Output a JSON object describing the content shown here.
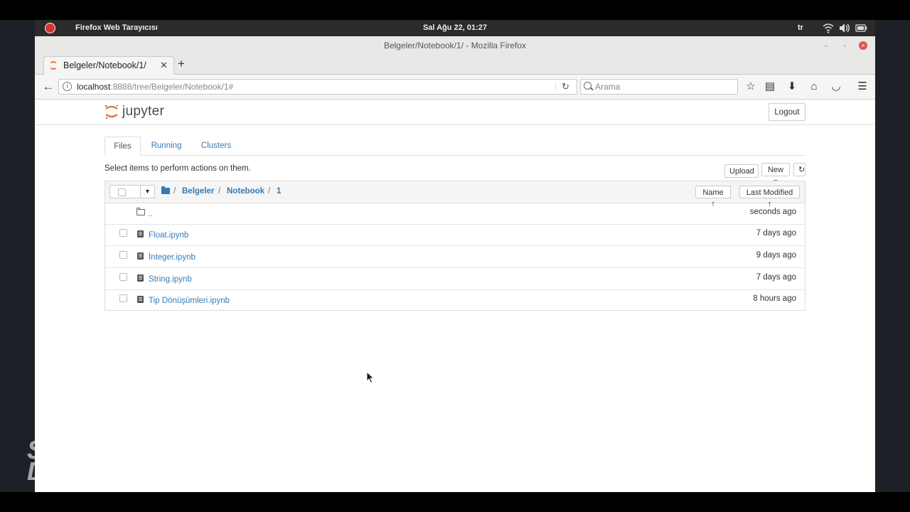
{
  "system_bar": {
    "app_name": "Firefox Web Tarayıcısı",
    "clock": "Sal Ağu 22, 01:27",
    "language": "tr"
  },
  "window": {
    "title": "Belgeler/Notebook/1/ - Mozilla Firefox"
  },
  "browser": {
    "tab_title": "Belgeler/Notebook/1/",
    "new_tab": "+",
    "url_host": "localhost",
    "url_path": ":8888/tree/Belgeler/Notebook/1#",
    "search_placeholder": "Arama"
  },
  "jupyter": {
    "wordmark": "jupyter",
    "logout_label": "Logout",
    "tabs": [
      "Files",
      "Running",
      "Clusters"
    ],
    "active_tab": "Files",
    "hint": "Select items to perform actions on them.",
    "upload_label": "Upload",
    "new_label": "New ▾",
    "breadcrumbs": [
      "Belgeler",
      "Notebook",
      "1"
    ],
    "sort_name": "Name ↑",
    "sort_modified": "Last Modified ↑",
    "parent_dir": {
      "name": "..",
      "modified": "seconds ago"
    },
    "files": [
      {
        "name": "Float.ipynb",
        "modified": "7 days ago"
      },
      {
        "name": "İnteger.ipynb",
        "modified": "9 days ago"
      },
      {
        "name": "String.ipynb",
        "modified": "7 days ago"
      },
      {
        "name": "Tip Dönüşümleri.ipynb",
        "modified": "8 hours ago"
      }
    ]
  },
  "watermark": {
    "text": "SO DIP"
  }
}
